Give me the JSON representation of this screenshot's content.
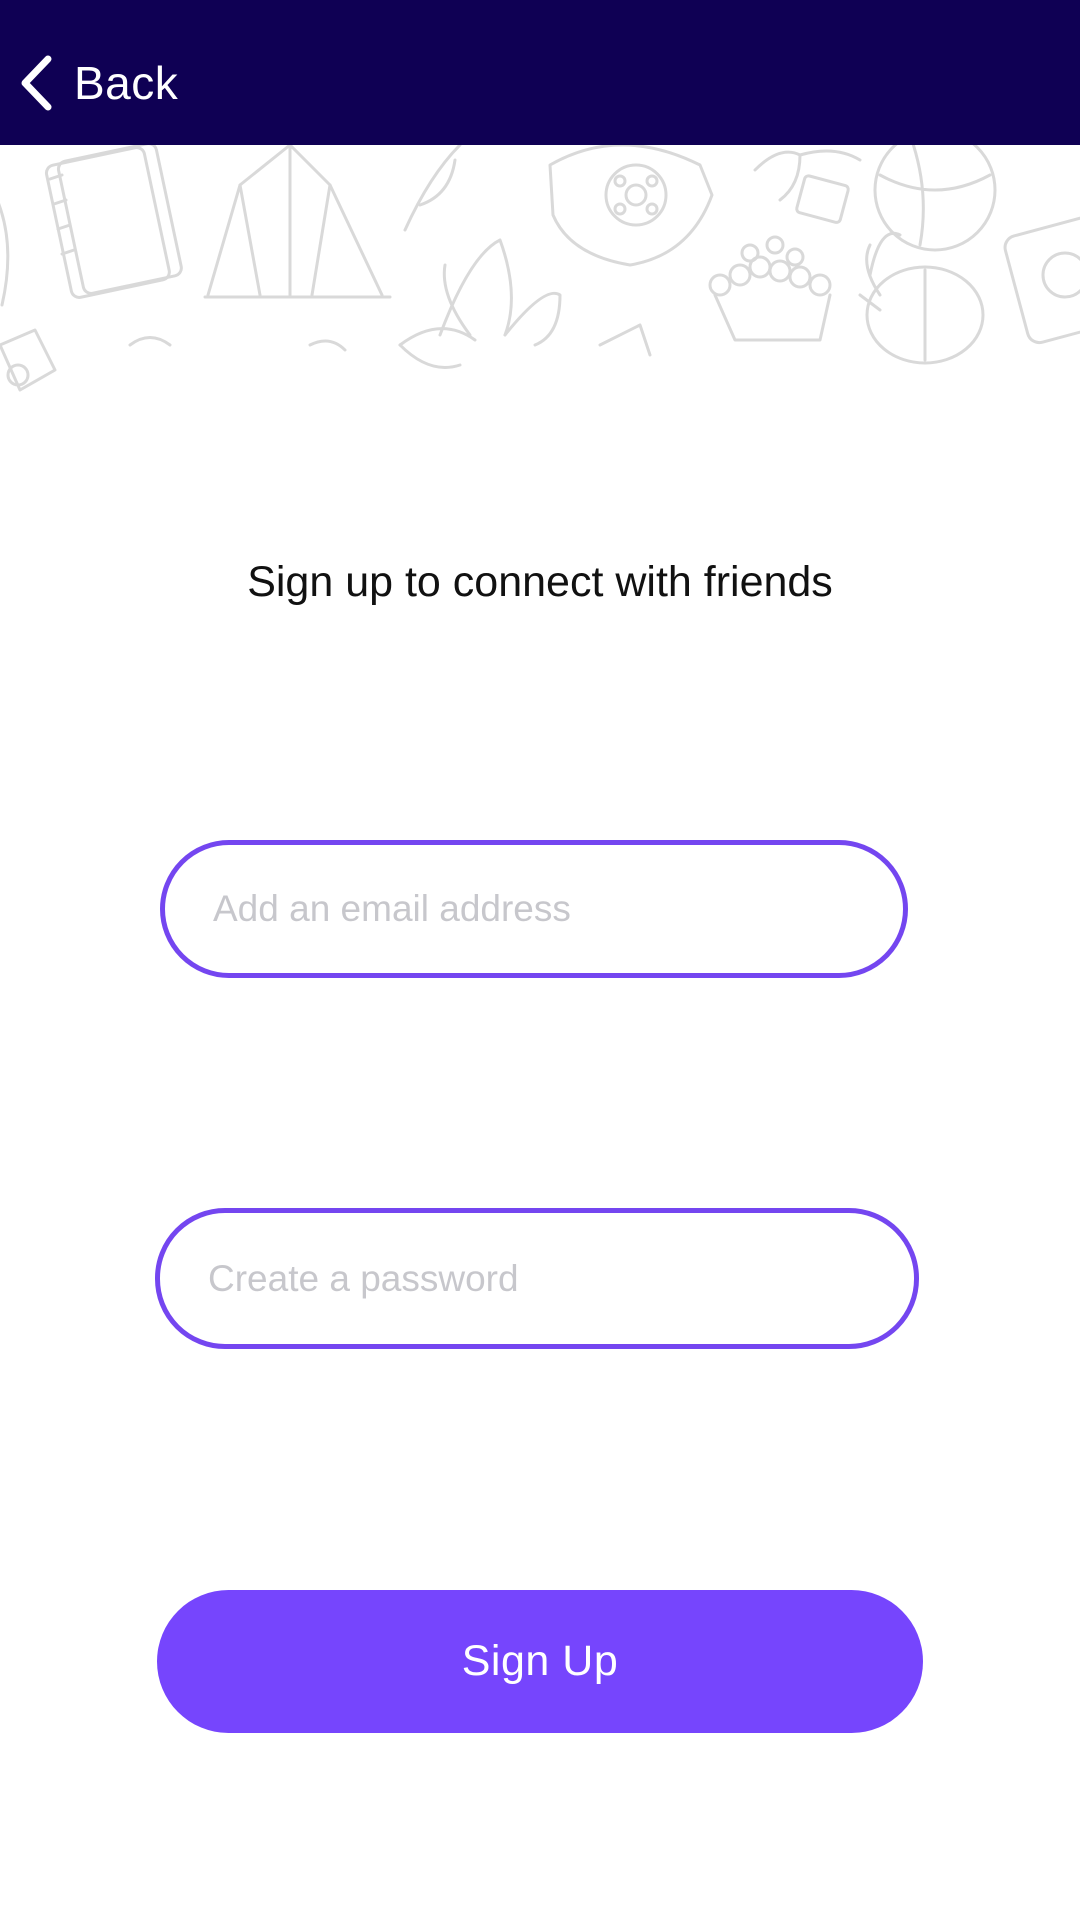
{
  "nav": {
    "back_label": "Back",
    "background": "#0f0054"
  },
  "header": {
    "decoration": "doodle-pattern"
  },
  "main": {
    "heading": "Sign up to connect with friends",
    "email_placeholder": "Add an email address",
    "email_value": "",
    "password_placeholder": "Create a password",
    "password_value": "",
    "signup_label": "Sign Up"
  },
  "colors": {
    "accent": "#7645fd",
    "field_border": "#7446f0",
    "placeholder": "#c7c7cc"
  },
  "icons": {
    "back": "chevron-left-icon"
  }
}
